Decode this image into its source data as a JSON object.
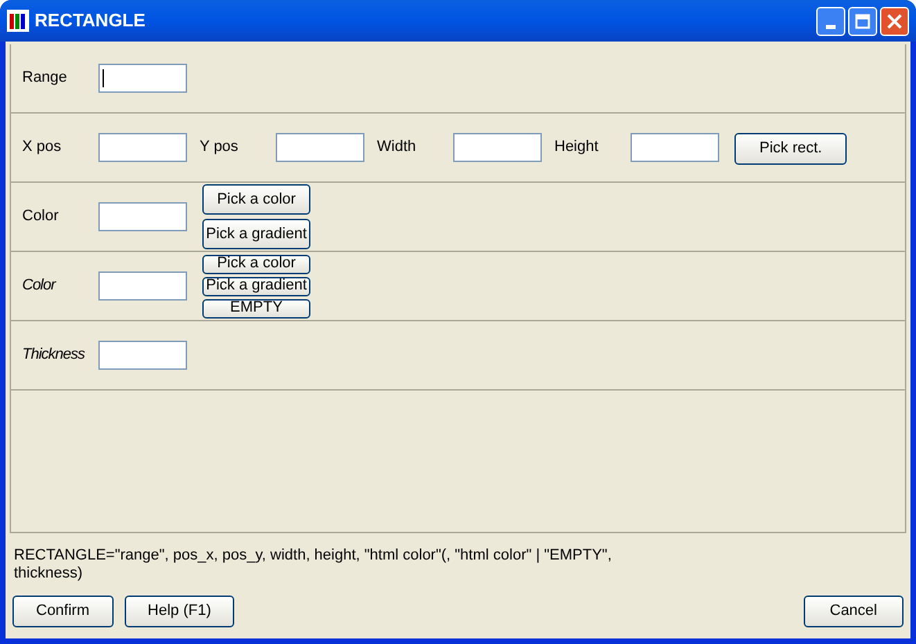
{
  "window": {
    "title": "RECTANGLE"
  },
  "sections": [
    {
      "items": [
        {
          "kind": "field",
          "label": "Range",
          "italic": false,
          "focused": true
        }
      ]
    },
    {
      "items": [
        {
          "kind": "field",
          "label": "X pos",
          "italic": false,
          "focused": false
        },
        {
          "kind": "field",
          "label": "Y pos",
          "italic": false,
          "focused": false
        },
        {
          "kind": "field",
          "label": "Width",
          "italic": false,
          "focused": false
        },
        {
          "kind": "field",
          "label": "Height",
          "italic": false,
          "focused": false
        },
        {
          "kind": "button",
          "label": "Pick rect."
        }
      ]
    },
    {
      "items": [
        {
          "kind": "field",
          "label": "Color",
          "italic": false,
          "focused": false
        },
        {
          "kind": "stack",
          "compact": false,
          "buttons": [
            "Pick a color",
            "Pick a gradient"
          ]
        }
      ]
    },
    {
      "items": [
        {
          "kind": "field",
          "label": "Color",
          "italic": true,
          "focused": false
        },
        {
          "kind": "stack",
          "compact": true,
          "buttons": [
            "Pick a color",
            "Pick a gradient",
            "EMPTY"
          ]
        }
      ]
    },
    {
      "items": [
        {
          "kind": "field",
          "label": "Thickness",
          "italic": true,
          "focused": false
        }
      ]
    }
  ],
  "syntax": "RECTANGLE=\"range\", pos_x, pos_y, width, height, \"html color\"(, \"html color\" | \"EMPTY\", thickness)",
  "buttons": {
    "left": [
      "Confirm",
      "Help (F1)"
    ],
    "right": [
      "Cancel"
    ]
  }
}
